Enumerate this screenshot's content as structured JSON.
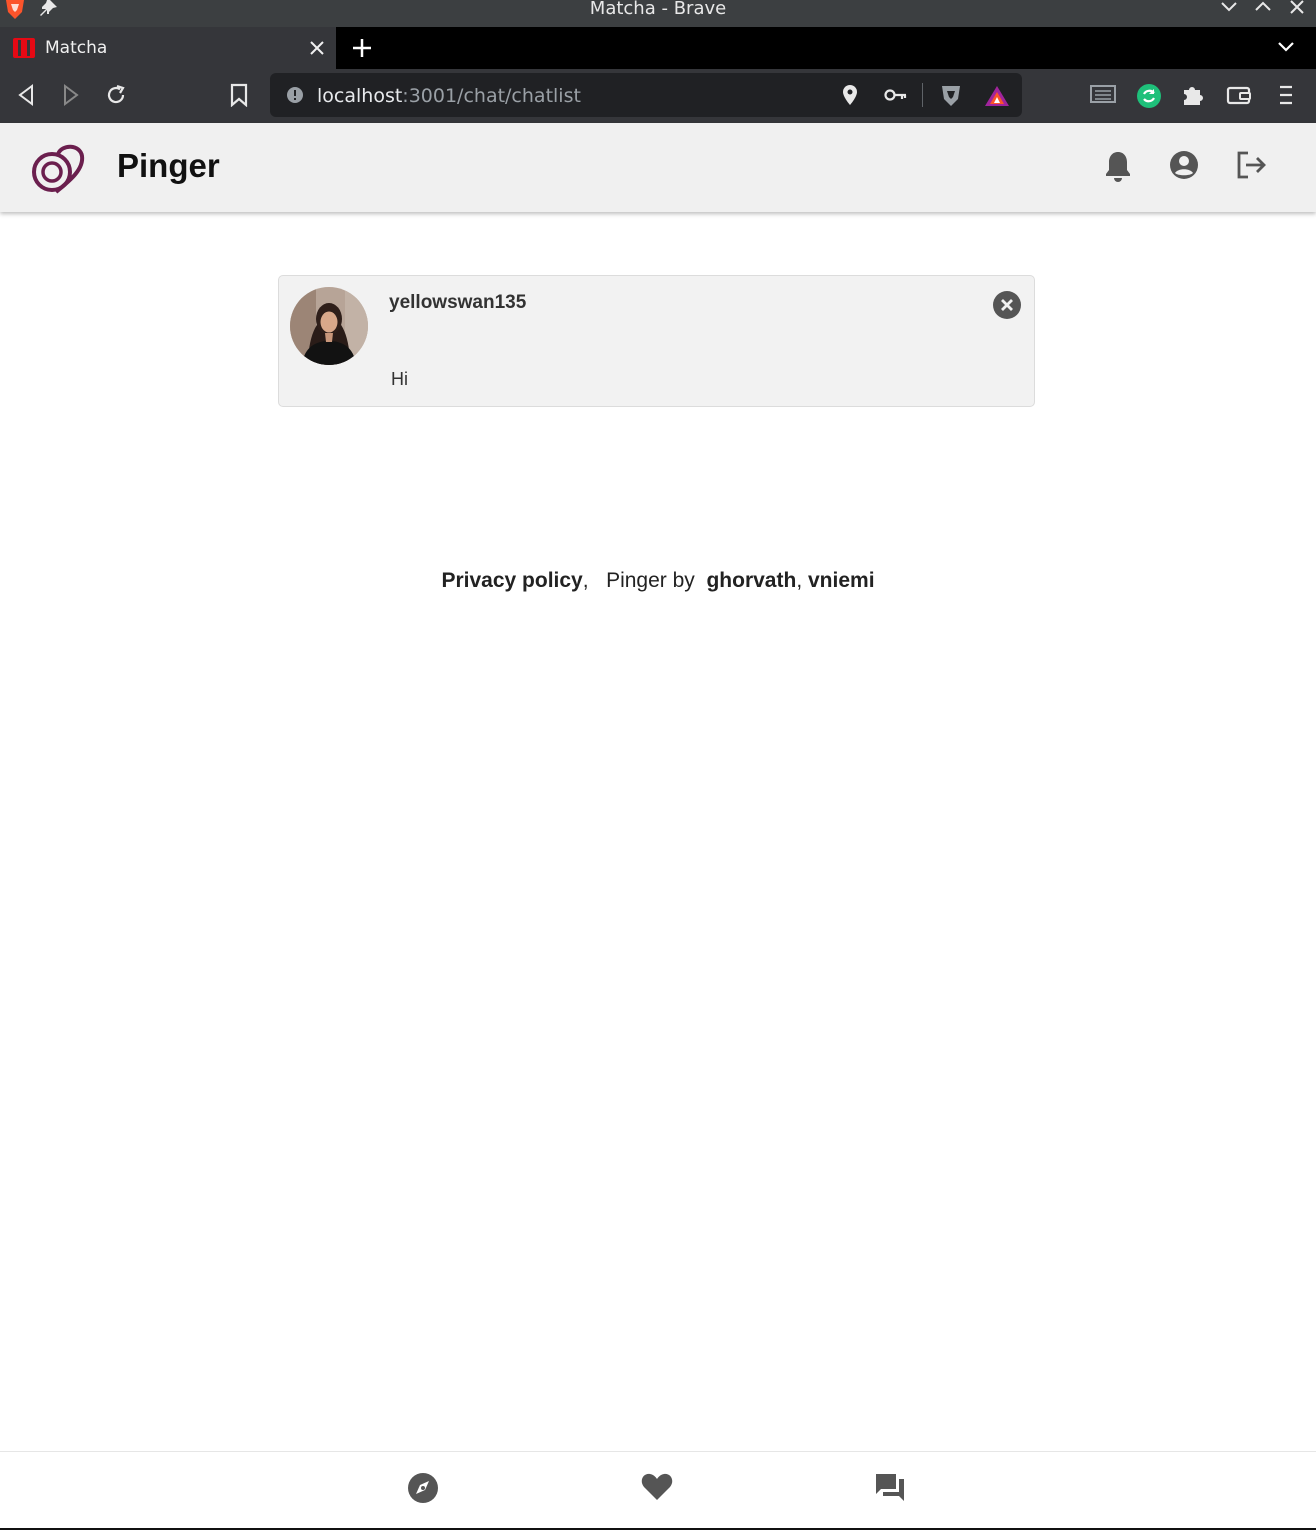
{
  "window": {
    "title": "Matcha - Brave"
  },
  "tab": {
    "title": "Matcha"
  },
  "address_bar": {
    "host": "localhost",
    "path": ":3001/chat/chatlist"
  },
  "app": {
    "name": "Pinger"
  },
  "chats": [
    {
      "username": "yellowswan135",
      "last_message": "Hi"
    }
  ],
  "footer": {
    "privacy": "Privacy policy",
    "comma1": ",",
    "by": "Pinger by",
    "author1": "ghorvath",
    "comma2": ",",
    "author2": "vniemi"
  },
  "colors": {
    "brand": "#6b1f4e",
    "header_bg": "#f0f0f0",
    "icon_gray": "#555555"
  },
  "icons": {
    "header": [
      "bell-icon",
      "account-circle-icon",
      "logout-icon"
    ],
    "bottom_nav": [
      "compass-icon",
      "heart-icon",
      "chat-icon"
    ]
  }
}
